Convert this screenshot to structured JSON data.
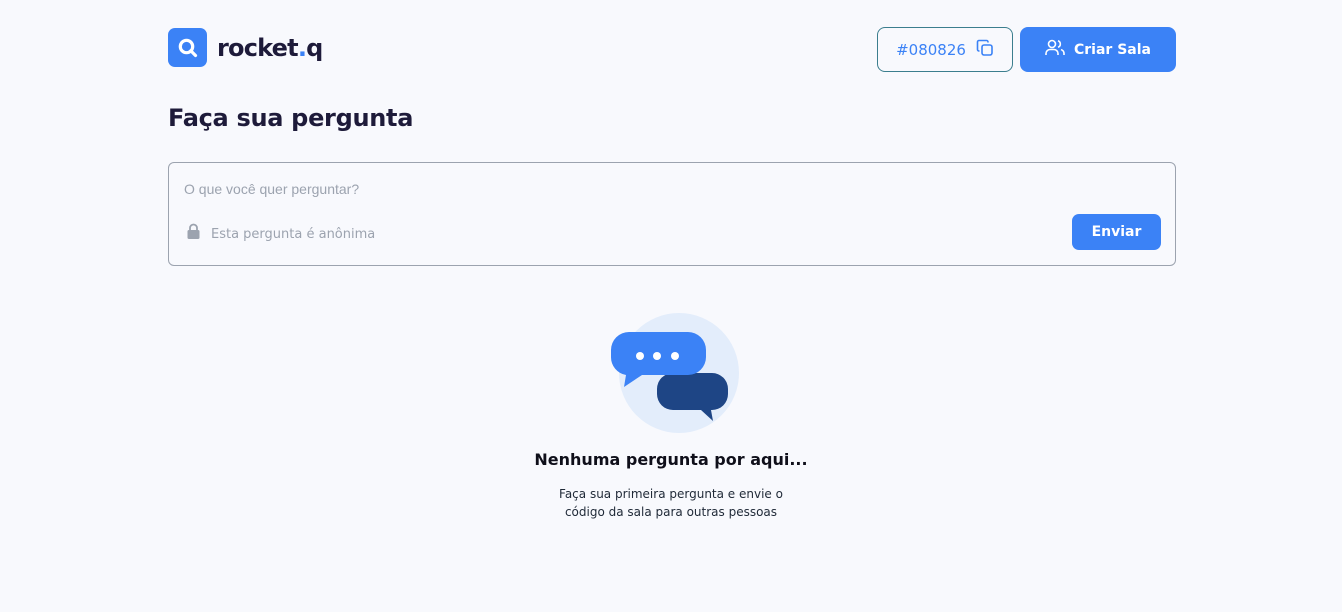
{
  "header": {
    "logo": {
      "text_main": "rocket",
      "text_dot": ".",
      "text_suffix": "q",
      "icon": "search-icon"
    },
    "room_code": {
      "label": "#080826",
      "icon": "copy-icon"
    },
    "create_room": {
      "label": "Criar Sala",
      "icon": "users-icon"
    }
  },
  "main": {
    "title": "Faça sua pergunta",
    "question": {
      "placeholder": "O que você quer perguntar?",
      "value": "",
      "anonymous_label": "Esta pergunta é anônima",
      "anonymous_icon": "lock-icon",
      "send_label": "Enviar"
    },
    "empty_state": {
      "icon": "chat-bubbles-icon",
      "title": "Nenhuma pergunta por aqui...",
      "description_line1": "Faça sua primeira pergunta e envie o",
      "description_line2": "código da sala para outras pessoas"
    }
  },
  "colors": {
    "accent": "#3b82f6",
    "title": "#1e1b3a",
    "background": "#f8f9fd",
    "bubble_dark": "#1e4585",
    "bubble_circle": "#e3edfb"
  }
}
